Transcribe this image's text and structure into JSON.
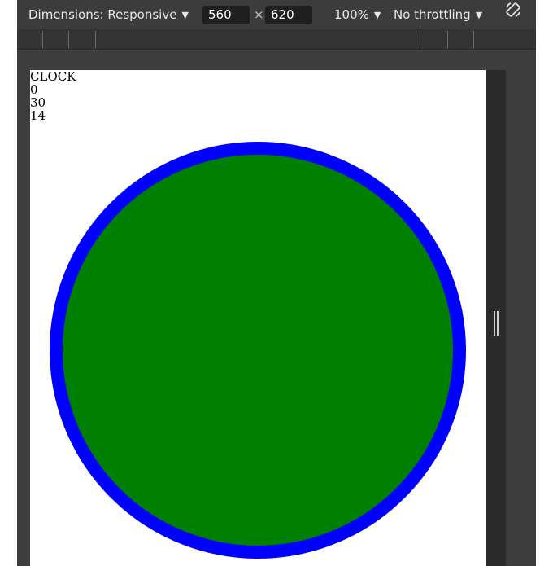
{
  "toolbar": {
    "dimensions_label": "Dimensions: Responsive",
    "width_value": "560",
    "times": "×",
    "height_value": "620",
    "zoom_label": "100%",
    "throttle_label": "No throttling",
    "caret": "▼"
  },
  "page": {
    "heading": "CLOCK",
    "line1": "0",
    "line2": "30",
    "line3": "14"
  },
  "clock": {
    "fill_color": "#008000",
    "stroke_color": "#0000ff"
  }
}
